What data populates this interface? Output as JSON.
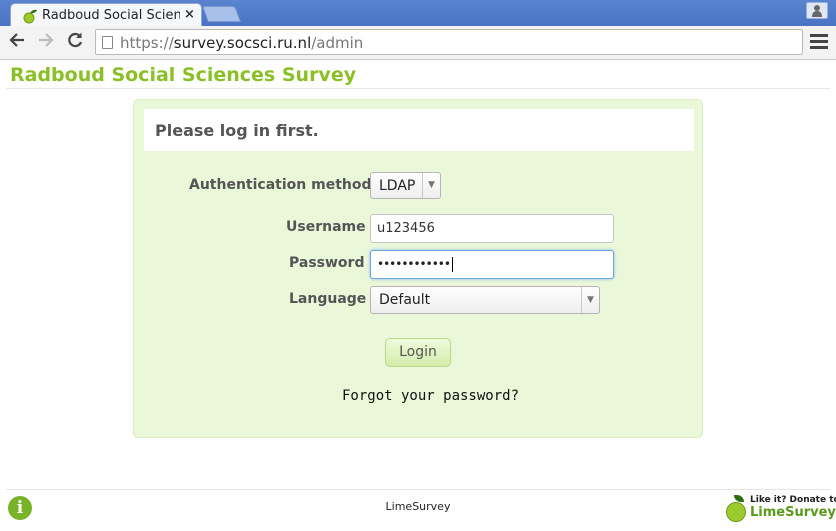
{
  "browser": {
    "tab_title": "Radboud Social Sciences Survey",
    "url_scheme": "https://",
    "url_host": "survey.socsci.ru.nl",
    "url_path": "/admin"
  },
  "site": {
    "title": "Radboud Social Sciences Survey"
  },
  "login": {
    "heading": "Please log in first.",
    "auth_label": "Authentication method",
    "auth_value": "LDAP",
    "username_label": "Username",
    "username_value": "u123456",
    "password_label": "Password",
    "password_masked": "••••••••••••",
    "language_label": "Language",
    "language_value": "Default",
    "login_button": "Login",
    "forgot_link": "Forgot your password?"
  },
  "footer": {
    "center_text": "LimeSurvey",
    "donate_line1": "Like it? Donate to",
    "donate_line2": "LimeSurvey"
  },
  "colors": {
    "brand_green": "#8ac026",
    "panel_bg": "#eaf7d9",
    "browser_blue": "#4a74c4"
  },
  "icons": {
    "favicon": "lime-icon",
    "back": "arrow-left-icon",
    "forward": "arrow-right-icon",
    "reload": "reload-icon",
    "menu": "hamburger-menu-icon",
    "info": "info-icon",
    "user": "user-icon"
  }
}
